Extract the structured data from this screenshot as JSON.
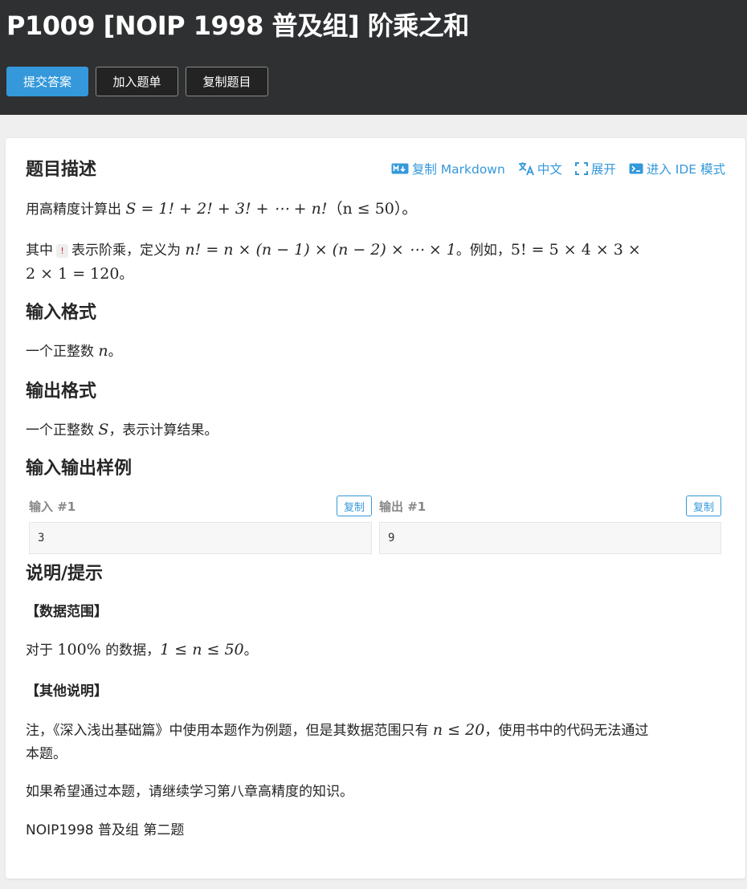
{
  "header": {
    "title": "P1009 [NOIP 1998 普及组] 阶乘之和",
    "buttons": {
      "submit": "提交答案",
      "add_to_list": "加入题单",
      "copy_problem": "复制题目"
    }
  },
  "toolbar": {
    "copy_markdown": "复制 Markdown",
    "language": "中文",
    "expand": "展开",
    "ide_mode": "进入 IDE 模式"
  },
  "sections": {
    "description": "题目描述",
    "input_format": "输入格式",
    "output_format": "输出格式",
    "samples": "输入输出样例",
    "hint": "说明/提示"
  },
  "description": {
    "line1_pre": "用高精度计算出 ",
    "line1_math": "S = 1! + 2! + 3! + ⋯ + n!",
    "line1_paren": "（n ≤ 50）。",
    "line2_pre": "其中",
    "line2_bang": "!",
    "line2_mid": "表示阶乘，定义为 ",
    "line2_math": "n! = n × (n − 1) × (n − 2) × ⋯ × 1",
    "line2_post": "。例如，",
    "line2_math2": "5! = 5 × 4 × 3 ×",
    "line3_math": "2 × 1 = 120",
    "line3_post": "。"
  },
  "input_format": {
    "pre": "一个正整数 ",
    "var": "n",
    "post": "。"
  },
  "output_format": {
    "pre": "一个正整数 ",
    "var": "S",
    "post": "，表示计算结果。"
  },
  "samples": {
    "input_label": "输入 #1",
    "output_label": "输出 #1",
    "copy_label": "复制",
    "input_value": "3",
    "output_value": "9"
  },
  "hint": {
    "range_title": "【数据范围】",
    "range_pre": "对于 ",
    "range_pct": "100%",
    "range_mid": " 的数据，",
    "range_math": "1 ≤ n ≤ 50",
    "range_post": "。",
    "other_title": "【其他说明】",
    "note_pre": "注，《深入浅出基础篇》中使用本题作为例题，但是其数据范围只有 ",
    "note_math": "n ≤ 20",
    "note_post": "，使用书中的代码无法通过",
    "note_line2": "本题。",
    "note_line3": "如果希望通过本题，请继续学习第八章高精度的知识。",
    "source": "NOIP1998 普及组 第二题"
  }
}
